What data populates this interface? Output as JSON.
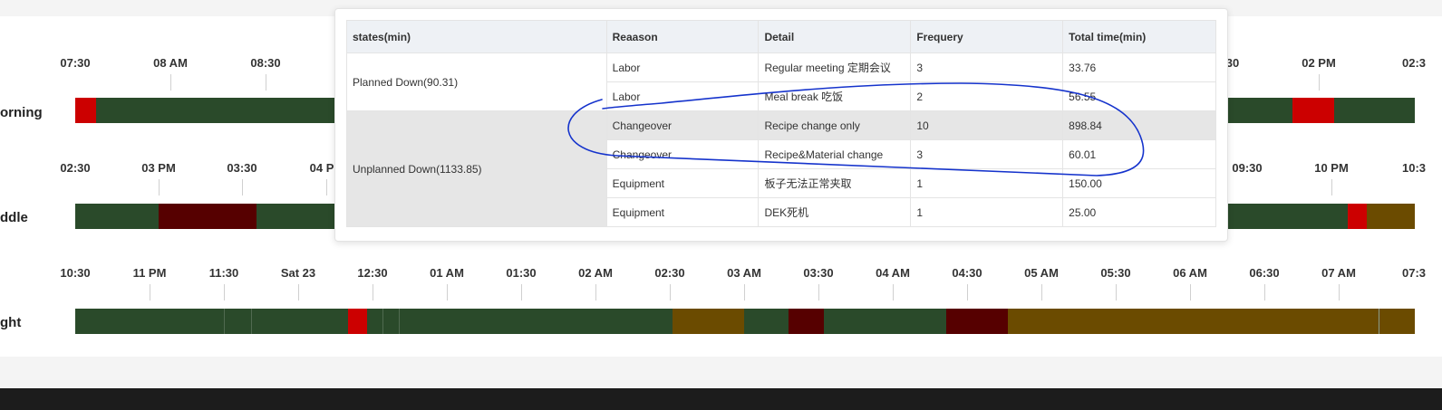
{
  "colors": {
    "running": "#2a4a2a",
    "planned_down": "#cc0000",
    "unplanned_down": "#560000",
    "idle": "#6b4b00",
    "annotation": "#1533cc"
  },
  "shifts": [
    {
      "label": "orning"
    },
    {
      "label": "ddle"
    },
    {
      "label": "ght"
    }
  ],
  "timeline": {
    "morning_ticks": [
      "07:30",
      "08 AM",
      "08:30",
      "30",
      "02 PM",
      "02:3"
    ],
    "middle_ticks": [
      "02:30",
      "03 PM",
      "03:30",
      "04 P",
      "09:30",
      "10 PM",
      "10:3"
    ],
    "night_ticks": [
      "10:30",
      "11 PM",
      "11:30",
      "Sat 23",
      "12:30",
      "01 AM",
      "01:30",
      "02 AM",
      "02:30",
      "03 AM",
      "03:30",
      "04 AM",
      "04:30",
      "05 AM",
      "05:30",
      "06 AM",
      "06:30",
      "07 AM",
      "07:3"
    ]
  },
  "tooltip": {
    "headers": [
      "states(min)",
      "Reaason",
      "Detail",
      "Frequery",
      "Total time(min)"
    ],
    "groups": {
      "planned": "Planned Down(90.31)",
      "unplanned": "Unplanned Down(1133.85)"
    },
    "rows": [
      {
        "reason": "Labor",
        "detail": "Regular meeting 定期会议",
        "frequency": "3",
        "total": "33.76"
      },
      {
        "reason": "Labor",
        "detail": "Meal break 吃饭",
        "frequency": "2",
        "total": "56.55"
      },
      {
        "reason": "Changeover",
        "detail": "Recipe change only",
        "frequency": "10",
        "total": "898.84"
      },
      {
        "reason": "Changeover",
        "detail": "Recipe&Material change",
        "frequency": "3",
        "total": "60.01"
      },
      {
        "reason": "Equipment",
        "detail": "板子无法正常夹取",
        "frequency": "1",
        "total": "150.00"
      },
      {
        "reason": "Equipment",
        "detail": "DEK死机",
        "frequency": "1",
        "total": "25.00"
      }
    ]
  }
}
